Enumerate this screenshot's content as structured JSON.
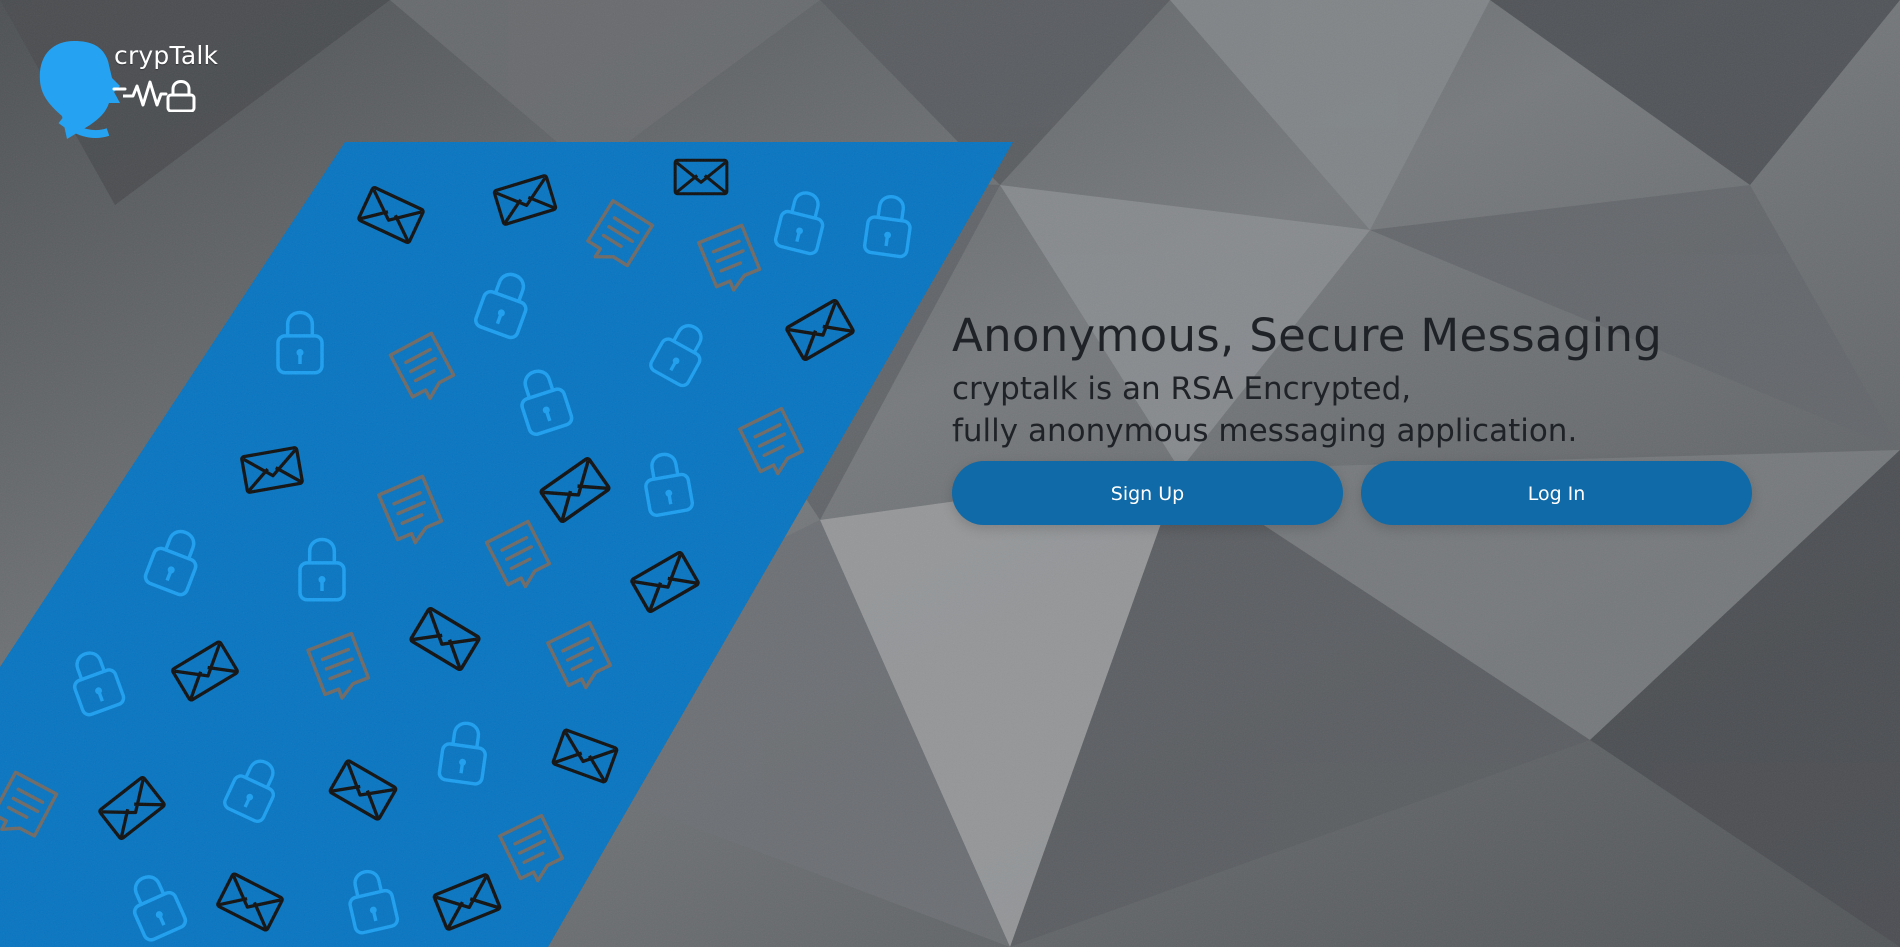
{
  "brand": {
    "name": "crypTalk",
    "accent": "#0873bf",
    "logo_icon": "speaking-head-lock-icon"
  },
  "hero": {
    "title": "Anonymous, Secure Messaging",
    "subtitle_line_1": "cryptalk is an RSA Encrypted,",
    "subtitle_line_2": "fully anonymous messaging application."
  },
  "actions": {
    "sign_up": "Sign Up",
    "log_in": "Log In"
  },
  "background": {
    "style": "dark-gray-triangular-polygon-pattern",
    "panel_color": "#0873bf",
    "pattern_icons": [
      "envelope-icon",
      "lock-icon",
      "message-icon"
    ]
  }
}
